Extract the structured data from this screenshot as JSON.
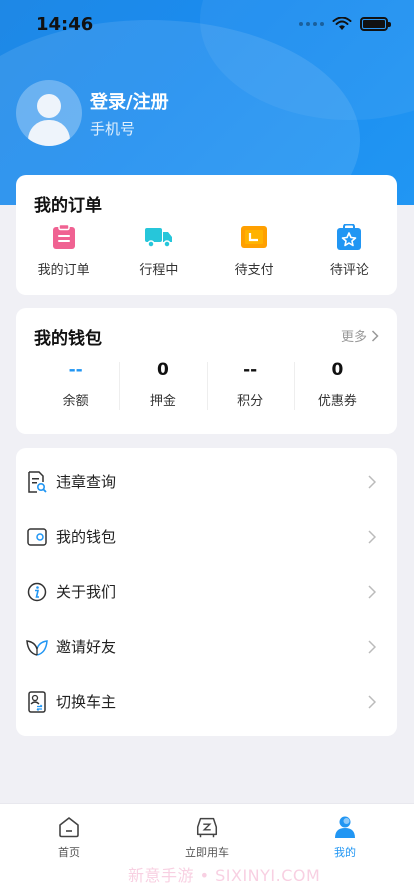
{
  "status_bar": {
    "time": "14:46"
  },
  "profile": {
    "login_label": "登录/注册",
    "phone_label": "手机号"
  },
  "orders": {
    "title": "我的订单",
    "items": [
      {
        "label": "我的订单",
        "icon": "clipboard-icon",
        "color": "#f06292"
      },
      {
        "label": "行程中",
        "icon": "truck-icon",
        "color": "#26c6da"
      },
      {
        "label": "待支付",
        "icon": "wallet-icon",
        "color": "#ffa000"
      },
      {
        "label": "待评论",
        "icon": "star-bag-icon",
        "color": "#2196f3"
      }
    ]
  },
  "wallet": {
    "title": "我的钱包",
    "more_label": "更多",
    "items": [
      {
        "value": "--",
        "label": "余额"
      },
      {
        "value": "0",
        "label": "押金"
      },
      {
        "value": "--",
        "label": "积分"
      },
      {
        "value": "0",
        "label": "优惠券"
      }
    ]
  },
  "menu": {
    "items": [
      {
        "label": "违章查询",
        "icon": "document-search-icon"
      },
      {
        "label": "我的钱包",
        "icon": "wallet-icon"
      },
      {
        "label": "关于我们",
        "icon": "info-icon"
      },
      {
        "label": "邀请好友",
        "icon": "leaf-icon"
      },
      {
        "label": "切换车主",
        "icon": "id-card-icon"
      }
    ]
  },
  "tabbar": {
    "tabs": [
      {
        "label": "首页",
        "icon": "home-icon",
        "active": false
      },
      {
        "label": "立即用车",
        "icon": "car-icon",
        "active": false
      },
      {
        "label": "我的",
        "icon": "user-icon",
        "active": true
      }
    ]
  },
  "watermark": "新意手游 • SIXINYI.COM",
  "colors": {
    "accent": "#2196f3",
    "hero_start": "#1e88e5",
    "background": "#f0f0f5"
  }
}
